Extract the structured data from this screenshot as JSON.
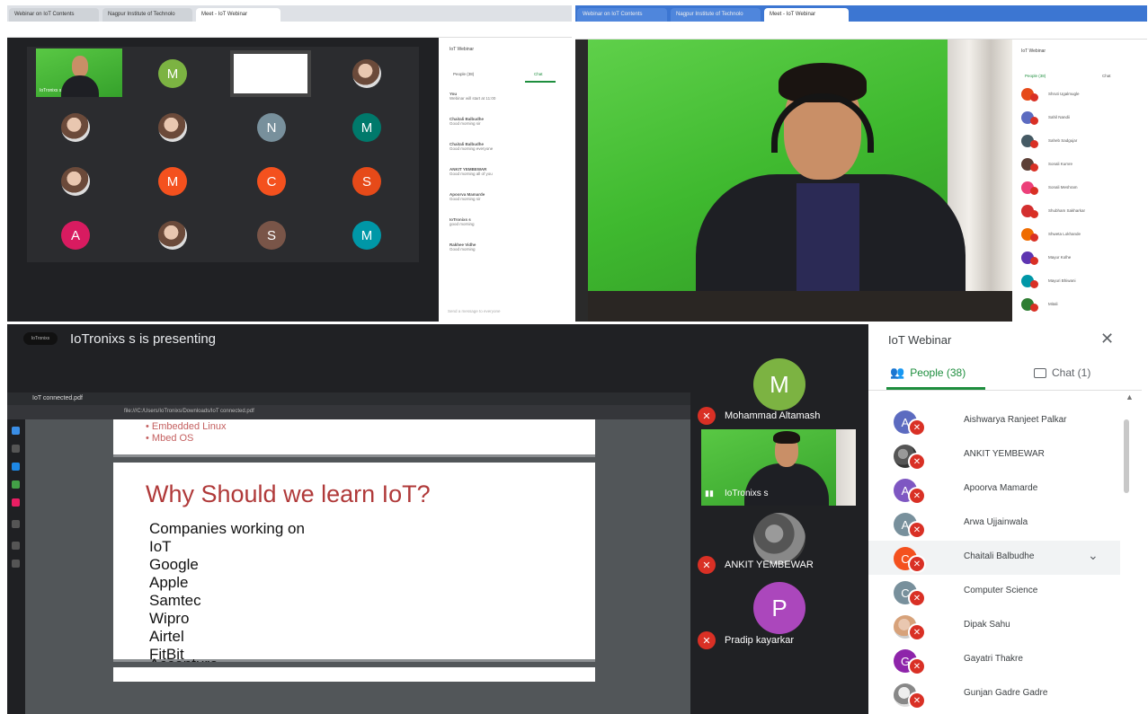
{
  "top_left": {
    "tabs": [
      "Webinar on IoT Contents",
      "Nagpur Institute of Technolo",
      "Meet - IoT Webinar"
    ],
    "grid": {
      "presenter_label": "IoTronixs s",
      "tiles": [
        {
          "letter": "M",
          "color": "#7cb342"
        },
        {
          "letter": "",
          "color": ""
        },
        {
          "letter": "",
          "color": ""
        },
        {
          "letter": "",
          "color": ""
        },
        {
          "letter": "",
          "color": ""
        },
        {
          "letter": "N",
          "color": "#78909c"
        },
        {
          "letter": "M",
          "color": "#00796b"
        },
        {
          "letter": "",
          "color": ""
        },
        {
          "letter": "M",
          "color": "#f4511e"
        },
        {
          "letter": "C",
          "color": "#f4511e"
        },
        {
          "letter": "S",
          "color": "#e64a19"
        },
        {
          "letter": "A",
          "color": "#d81b60"
        },
        {
          "letter": "",
          "color": ""
        },
        {
          "letter": "S",
          "color": "#795548"
        },
        {
          "letter": "M",
          "color": "#0097a7"
        }
      ]
    },
    "chat": {
      "title": "IoT Webinar",
      "people_tab": "People (38)",
      "chat_tab": "Chat",
      "messages": [
        {
          "name": "You",
          "text": "Webinar will start at 11:00"
        },
        {
          "name": "Chaitali Balbudhe",
          "text": "Good morning sir"
        },
        {
          "name": "Chaitali Balbudhe",
          "text": "Good morning everyone"
        },
        {
          "name": "ANKIT YEMBEWAR",
          "text": "Good morning all of you"
        },
        {
          "name": "Apoorva Mamarde",
          "text": "Good morning sir"
        },
        {
          "name": "IoTronixs s",
          "text": "good morning"
        },
        {
          "name": "Rakhee Vidhe",
          "text": "Good morning"
        }
      ],
      "input_placeholder": "Send a message to everyone"
    }
  },
  "top_right": {
    "tabs": [
      "Webinar on IoT Contents",
      "Nagpur Institute of Technolo",
      "Meet - IoT Webinar"
    ],
    "people_title": "IoT Webinar",
    "people_tab": "People (38)",
    "chat_tab": "Chat",
    "people": [
      {
        "name": "Shruti Ugalmugle",
        "color": "#e64a19"
      },
      {
        "name": "Sahil Nandii",
        "color": "#5c6bc0"
      },
      {
        "name": "Saheb Sadgujar",
        "color": "#455a64"
      },
      {
        "name": "Sonali Kumre",
        "color": "#5d4037"
      },
      {
        "name": "Sonali Meshram",
        "color": "#ec407a"
      },
      {
        "name": "Shubham Sakharkar",
        "color": "#d32f2f"
      },
      {
        "name": "Shweta Lokhande",
        "color": "#ef6c00"
      },
      {
        "name": "Mayur Kolhe",
        "color": "#5e35b1"
      },
      {
        "name": "Mayuri Bhiwani",
        "color": "#0097a7"
      },
      {
        "name": "Mitali",
        "color": "#2e7d32"
      }
    ]
  },
  "bottom": {
    "presenting_logo": "IoTronixs",
    "presenting_text": "IoTronixs s is presenting",
    "viewer_tab": "IoT connected.pdf",
    "viewer_path": "file:///C:/Users/IoTronixs/Downloads/IoT connected.pdf",
    "page1_bullets": [
      "Embedded Linux",
      "Mbed OS"
    ],
    "slide_title": "Why Should we learn IoT?",
    "slide_lines": [
      "Companies working on",
      "IoT",
      "Google",
      "Apple",
      "Samtec",
      "Wipro",
      "Airtel",
      "FitBit"
    ],
    "slide_cut_line": "Accenture",
    "tiles": {
      "top_letter": "M",
      "top_name": "Mohammad Altamash",
      "presenter_name": "IoTronixs s",
      "ankit_name": "ANKIT YEMBEWAR",
      "bottom_letter": "P",
      "bottom_name": "Pradip kayarkar"
    },
    "people_panel": {
      "title": "IoT Webinar",
      "people_tab": "People (38)",
      "chat_tab": "Chat (1)",
      "people": [
        {
          "letter": "A",
          "name": "Aishwarya Ranjeet Palkar",
          "color": "#5c6bc0"
        },
        {
          "letter": "",
          "name": "ANKIT YEMBEWAR",
          "color": "#444444"
        },
        {
          "letter": "A",
          "name": "Apoorva Mamarde",
          "color": "#7e57c2"
        },
        {
          "letter": "A",
          "name": "Arwa Ujjainwala",
          "color": "#78909c"
        },
        {
          "letter": "C",
          "name": "Chaitali Balbudhe",
          "color": "#f4511e"
        },
        {
          "letter": "C",
          "name": "Computer Science",
          "color": "#78909c"
        },
        {
          "letter": "",
          "name": "Dipak Sahu",
          "color": "#d7a27a"
        },
        {
          "letter": "G",
          "name": "Gayatri Thakre",
          "color": "#8e24aa"
        },
        {
          "letter": "",
          "name": "Gunjan Gadre Gadre",
          "color": "#bbbbbb"
        }
      ]
    }
  }
}
